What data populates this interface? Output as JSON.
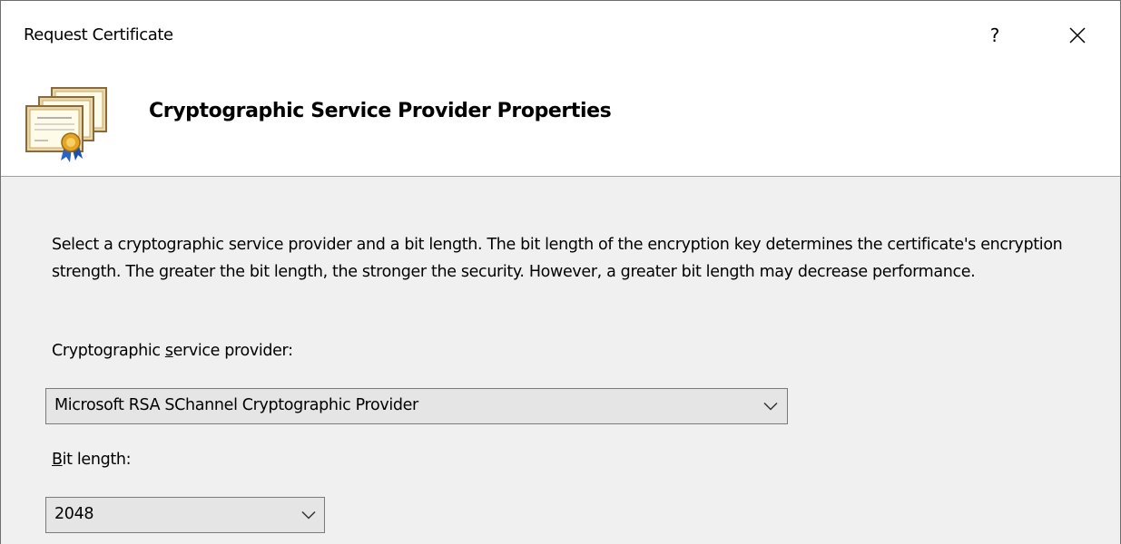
{
  "window": {
    "title": "Request Certificate",
    "help_label": "?"
  },
  "header": {
    "heading": "Cryptographic Service Provider Properties",
    "icon": "certificate-icon"
  },
  "content": {
    "description": "Select a cryptographic service provider and a bit length. The bit length of the encryption key determines the certificate's encryption strength. The greater the bit length, the stronger the security. However, a greater bit length may decrease performance.",
    "csp_label_pre": "Cryptographic ",
    "csp_label_accel": "s",
    "csp_label_post": "ervice provider:",
    "csp_value": "Microsoft RSA SChannel Cryptographic Provider",
    "bit_label_accel": "B",
    "bit_label_post": "it length:",
    "bit_value": "2048"
  }
}
